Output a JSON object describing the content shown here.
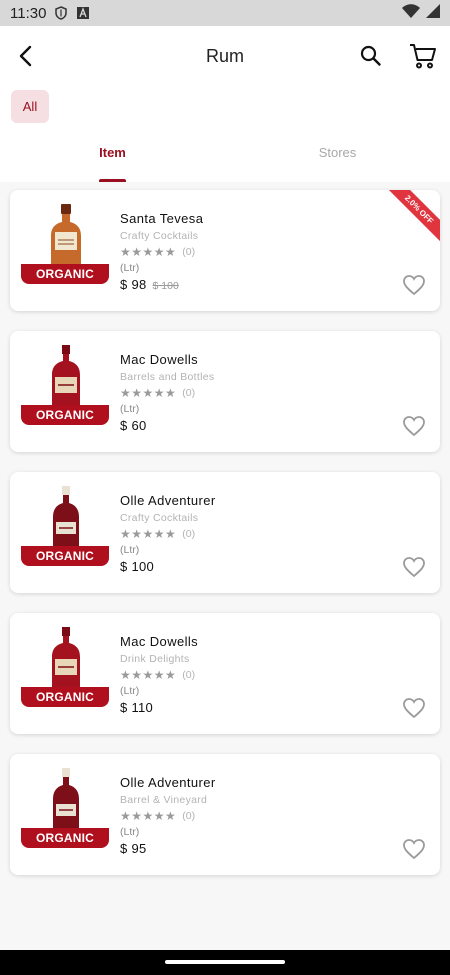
{
  "status_bar": {
    "time": "11:30",
    "icons": [
      "shield-icon",
      "a-notification-icon",
      "wifi-icon",
      "signal-icon"
    ]
  },
  "header": {
    "title": "Rum",
    "icons": [
      "back-arrow-icon",
      "search-icon",
      "cart-icon"
    ]
  },
  "filters": {
    "chip_all": "All"
  },
  "tabs": [
    {
      "label": "Item",
      "active": true
    },
    {
      "label": "Stores",
      "active": false
    }
  ],
  "products": [
    {
      "name": "Santa Tevesa",
      "store": "Crafty Cocktails",
      "rating_count": "(0)",
      "unit": "(Ltr)",
      "price": "$ 98",
      "old_price": "$ 100",
      "badge": "ORGANIC",
      "discount": "2.0% OFF",
      "bottle": "amber"
    },
    {
      "name": "Mac Dowells",
      "store": "Barrels and Bottles",
      "rating_count": "(0)",
      "unit": "(Ltr)",
      "price": "$ 60",
      "old_price": "",
      "badge": "ORGANIC",
      "discount": "",
      "bottle": "red"
    },
    {
      "name": "Olle Adventurer",
      "store": "Crafty Cocktails",
      "rating_count": "(0)",
      "unit": "(Ltr)",
      "price": "$ 100",
      "old_price": "",
      "badge": "ORGANIC",
      "discount": "",
      "bottle": "dark"
    },
    {
      "name": "Mac Dowells",
      "store": "Drink Delights",
      "rating_count": "(0)",
      "unit": "(Ltr)",
      "price": "$ 110",
      "old_price": "",
      "badge": "ORGANIC",
      "discount": "",
      "bottle": "red"
    },
    {
      "name": "Olle Adventurer",
      "store": "Barrel & Vineyard",
      "rating_count": "(0)",
      "unit": "(Ltr)",
      "price": "$ 95",
      "old_price": "",
      "badge": "ORGANIC",
      "discount": "",
      "bottle": "dark"
    }
  ],
  "colors": {
    "brand": "#9b1020",
    "badge": "#b00f1d",
    "discount_ribbon": "#e0343f",
    "chip_bg": "#f6dfe2"
  }
}
